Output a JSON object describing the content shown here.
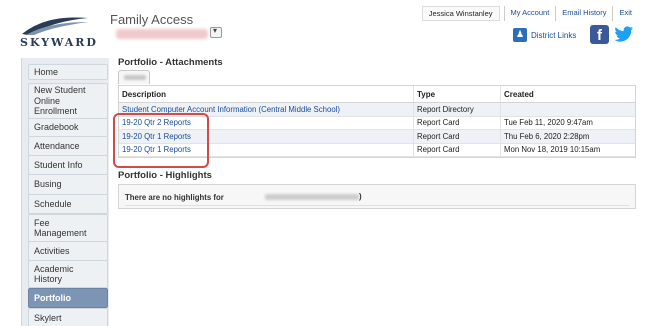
{
  "app": {
    "logo_text": "SKYWARD",
    "title": "Family Access"
  },
  "top_links": {
    "user": "Jessica Winstanley",
    "my_account": "My Account",
    "email_history": "Email History",
    "exit": "Exit"
  },
  "district_links": "District Links",
  "social": {
    "facebook": "f"
  },
  "sidebar": {
    "items": [
      {
        "label": "Home",
        "active": false
      },
      {
        "label": "New Student Online Enrollment",
        "active": false
      },
      {
        "label": "Gradebook",
        "active": false
      },
      {
        "label": "Attendance",
        "active": false
      },
      {
        "label": "Student Info",
        "active": false
      },
      {
        "label": "Busing",
        "active": false
      },
      {
        "label": "Schedule",
        "active": false
      },
      {
        "label": "Fee Management",
        "active": false
      },
      {
        "label": "Activities",
        "active": false
      },
      {
        "label": "Academic History",
        "active": false
      },
      {
        "label": "Portfolio",
        "active": true
      },
      {
        "label": "Skylert",
        "active": false
      }
    ]
  },
  "attachments": {
    "title": "Portfolio - Attachments",
    "columns": [
      "Description",
      "Type",
      "Created"
    ],
    "rows": [
      {
        "description": "Student Computer Account Information (Central Middle School)",
        "type": "Report Directory",
        "created": ""
      },
      {
        "description": "19-20 Qtr 2 Reports",
        "type": "Report Card",
        "created": "Tue Feb 11, 2020 9:47am"
      },
      {
        "description": "19-20 Qtr 1 Reports",
        "type": "Report Card",
        "created": "Thu Feb 6, 2020 2:28pm"
      },
      {
        "description": "19-20 Qtr 1 Reports",
        "type": "Report Card",
        "created": "Mon Nov 18, 2019 10:15am"
      }
    ]
  },
  "highlights": {
    "title": "Portfolio - Highlights",
    "message": "There are no highlights for",
    "closing": ")"
  },
  "colors": {
    "link": "#1a4d99",
    "annotation_outline": "#d24a4a",
    "active_nav": "#7d95b5"
  }
}
